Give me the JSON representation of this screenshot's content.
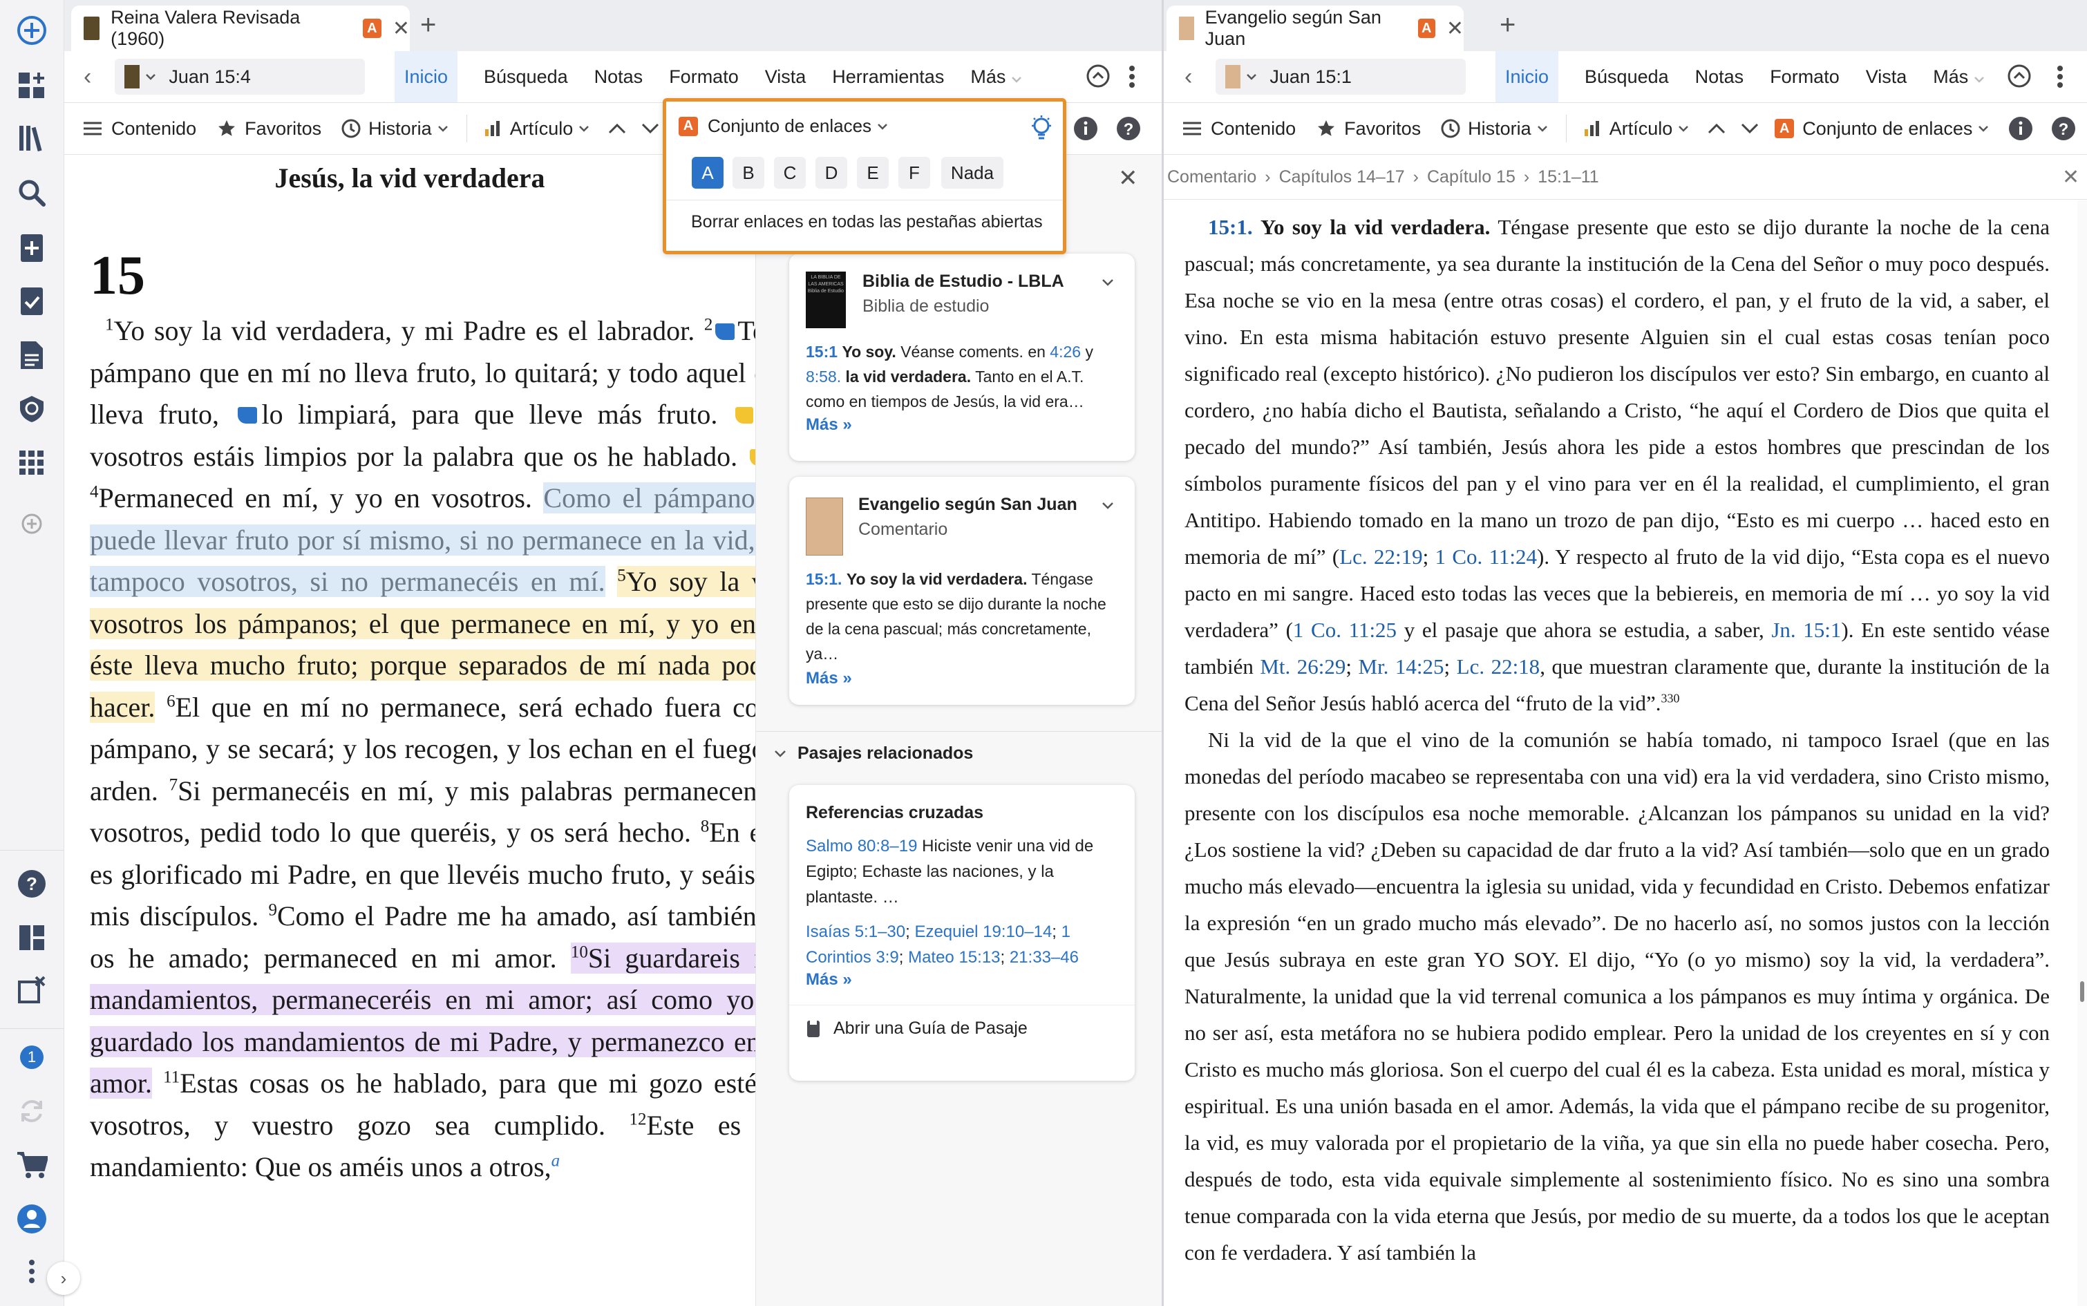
{
  "left_pane": {
    "tab_title": "Reina Valera Revisada (1960)",
    "reference": "Juan 15:4",
    "menu": [
      "Inicio",
      "Búsqueda",
      "Notas",
      "Formato",
      "Vista",
      "Herramientas",
      "Más"
    ],
    "toolbar": {
      "contents": "Contenido",
      "favorites": "Favoritos",
      "history": "Historia",
      "article": "Artículo",
      "link_set": "Conjunto de enlaces"
    },
    "heading": "Jesús, la vid verdadera",
    "chapter": "15",
    "verses": [
      {
        "n": "1",
        "text": "Yo soy la vid verdadera, y mi Padre es el labrador."
      },
      {
        "n": "2",
        "text": "Todo pámpano que en mí no lleva fruto, lo quitará; y todo aquel que lleva fruto,"
      },
      {
        "n": "",
        "text": "lo limpiará, para que lleve más fruto."
      },
      {
        "n": "3",
        "text": "Ya vosotros estáis limpios por la palabra que os he hablado."
      },
      {
        "n": "4",
        "text": "Permaneced en mí, y yo en vosotros."
      },
      {
        "n": "",
        "text": "Como el pámpano no puede llevar fruto por sí mismo, si no permanece en la vid, así tampoco vosotros, si no permanecéis en mí."
      },
      {
        "n": "5",
        "text": "Yo soy la vid, vosotros los pámpanos; el que permanece en mí, y yo en él, éste lleva mucho fruto; porque separados de mí nada podéis hacer."
      },
      {
        "n": "6",
        "text": "El que en mí no permanece, será echado fuera como pámpano, y se secará; y los recogen, y los echan en el fuego, y arden."
      },
      {
        "n": "7",
        "text": "Si permanecéis en mí, y mis palabras permanecen en vosotros, pedid todo lo que queréis, y os será hecho."
      },
      {
        "n": "8",
        "text": "En esto es glorificado mi Padre, en que llevéis mucho fruto, y seáis así mis discípulos."
      },
      {
        "n": "9",
        "text": "Como el Padre me ha amado, así también yo os he amado; permaneced en mi amor."
      },
      {
        "n": "10",
        "text": "Si guardareis mis mandamientos, permaneceréis en mi amor; así como yo he guardado los mandamientos de mi Padre, y permanezco en su amor."
      },
      {
        "n": "11",
        "text": "Estas cosas os he hablado, para que mi gozo esté en vosotros, y vuestro gozo sea cumplido."
      },
      {
        "n": "12",
        "text": "Este es mi mandamiento: Que os améis unos a otros,"
      },
      {
        "n": "",
        "text": "a"
      }
    ]
  },
  "link_popup": {
    "title": "Conjunto de enlaces",
    "options": [
      "A",
      "B",
      "C",
      "D",
      "E",
      "F",
      "Nada"
    ],
    "clear_label": "Borrar enlaces en todas las pestañas abiertas"
  },
  "guide_panel": {
    "cards": [
      {
        "title": "Biblia de Estudio - LBLA",
        "subtitle": "Biblia de estudio",
        "ref": "15:1",
        "bold1": "Yo soy.",
        "text1": "Véanse coments. en",
        "link1": "4:26",
        "and": "y",
        "link2": "8:58.",
        "bold2": "la vid verdadera.",
        "text2": "Tanto en el A.T. como en tiempos de Jesús, la vid era…",
        "more": "Más »",
        "cover_title": "LA BIBLIA DE LAS AMERICAS",
        "cover_sub": "Biblia de Estudio"
      },
      {
        "title": "Evangelio según San Juan",
        "subtitle": "Comentario",
        "ref": "15:1.",
        "bold1": "Yo soy la vid verdadera.",
        "text1": "Téngase presente que esto se dijo durante la noche de la cena pascual; más concretamente, ya…",
        "more": "Más »"
      }
    ],
    "related_header": "Pasajes relacionados",
    "cross_refs_title": "Referencias cruzadas",
    "cross_ref_1_link": "Salmo 80:8–19",
    "cross_ref_1_text": "Hiciste venir una vid de Egipto; Echaste las naciones, y la plantaste. …",
    "cross_ref_2a": "Isaías 5:1–30",
    "cross_ref_2b": "Ezequiel 19:10–14",
    "cross_ref_2c": "1 Corintios 3:9",
    "cross_ref_2d": "Mateo 15:13",
    "cross_ref_2e": "21:33–46",
    "cross_more": "Más »",
    "open_guide": "Abrir una Guía de Pasaje"
  },
  "right_pane": {
    "tab_title": "Evangelio según San Juan",
    "reference": "Juan 15:1",
    "menu": [
      "Inicio",
      "Búsqueda",
      "Notas",
      "Formato",
      "Vista",
      "Más"
    ],
    "toolbar": {
      "contents": "Contenido",
      "favorites": "Favoritos",
      "history": "Historia",
      "article": "Artículo",
      "link_set": "Conjunto de enlaces"
    },
    "breadcrumb": [
      "Comentario",
      "Capítulos 14–17",
      "Capítulo 15",
      "15:1–11"
    ],
    "p1_ref": "15:1.",
    "p1_bold": "Yo soy la vid verdadera.",
    "p1_text": "Téngase presente que esto se dijo durante la noche de la cena pascual; más concretamente, ya sea durante la institución de la Cena del Señor o muy poco después. Esa noche se vio en la mesa (entre otras cosas) el cordero, el pan, y el fruto de la vid, a saber, el vino. En esta misma habitación estuvo presente Alguien sin el cual estas cosas tenían poco significado real (excepto histórico). ¿No pudieron los discípulos ver esto? Sin embargo, en cuanto al cordero, ¿no había dicho el Bautista, señalando a Cristo, “he aquí el Cordero de Dios que quita el pecado del mundo?” Así también, Jesús ahora les pide a estos hombres que prescindan de los símbolos puramente físicos del pan y el vino para ver en él la realidad, el cumplimiento, el gran Antitipo. Habiendo tomado en la mano un trozo de pan dijo, “Esto es mi cuerpo … haced esto en memoria de mí”",
    "p1_links": [
      "Lc. 22:19",
      "1 Co. 11:24"
    ],
    "p1_text2": "Y respecto al fruto de la vid dijo, “Esta copa es el nuevo pacto en mi sangre. Haced esto todas las veces que la bebiereis, en memoria de mí … yo soy la vid verdadera”",
    "p1_links2": [
      "1 Co. 11:25",
      "Jn. 15:1",
      "Mt. 26:29",
      "Mr. 14:25",
      "Lc. 22:18"
    ],
    "p1_text3a": "y el pasaje que ahora se estudia, a saber,",
    "p1_text3b": "En este sentido véase también",
    "p1_text4": "que muestran claramente que, durante la institución de la Cena del Señor Jesús habló acerca del “fruto de la vid”.",
    "p1_foot": "330",
    "p2_text": "Ni la vid de la que el vino de la comunión se había tomado, ni tampoco Israel (que en las monedas del período macabeo se representaba con una vid) era la vid verdadera, sino Cristo mismo, presente con los discípulos esa noche memorable. ¿Alcanzan los pámpanos su unidad en la vid? ¿Los sostiene la vid? ¿Deben su capacidad de dar fruto a la vid? Así también—solo que en un grado mucho más elevado—encuentra la iglesia su unidad, vida y fecundidad en Cristo. Debemos enfatizar la expresión “en un grado mucho más elevado”. De no hacerlo así, no somos justos con la lección que Jesús subraya en este gran YO SOY. El dijo, “Yo (o yo mismo) soy la vid, la verdadera”. Naturalmente, la unidad que la vid terrenal comunica a los pámpanos es muy íntima y orgánica. De no ser así, esta metáfora no se hubiera podido emplear. Pero la unidad de los creyentes en sí y con Cristo es mucho más gloriosa. Son el cuerpo del cual él es la cabeza. Esta unidad es moral, mística y espiritual. Es una unión basada en el amor. Además, la vida que el pámpano recibe de su progenitor, la vid, es muy valorada por el propietario de la viña, ya que sin ella no puede haber cosecha. Pero, después de todo, esta vida equivale simplemente al sostenimiento físico. No es sino una sombra tenue comparada con la vida eterna que Jesús, por medio de su muerte, da a todos los que le aceptan con fe verdadera. Y así también la"
  },
  "rail": {
    "notification_count": "1"
  },
  "colors": {
    "accent_blue": "#2a73c9",
    "popup_border": "#e8902a",
    "badge_orange": "#e8682a",
    "highlight_blue": "#dce9f7",
    "highlight_yellow": "#fbf0c7",
    "highlight_purple": "#eadcf9"
  }
}
